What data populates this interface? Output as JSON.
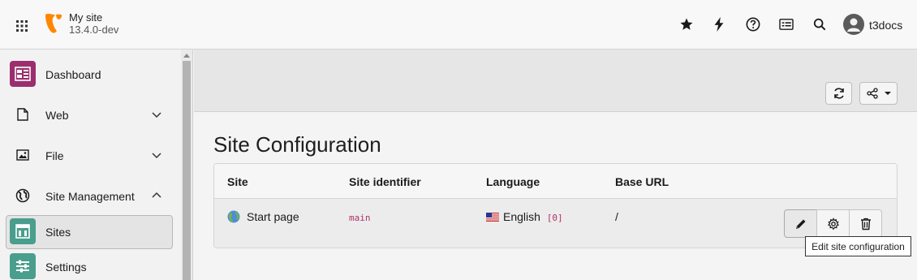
{
  "topbar": {
    "site_name": "My site",
    "site_version": "13.4.0-dev",
    "user_name": "t3docs",
    "icons": [
      "apps-icon",
      "star-icon",
      "bolt-icon",
      "help-icon",
      "list-icon",
      "search-icon",
      "user-avatar-icon"
    ],
    "brand_color": "#ff8700"
  },
  "sidebar": {
    "items": [
      {
        "label": "Dashboard",
        "icon": "dashboard-icon",
        "color": "#9b2e6e"
      },
      {
        "label": "Web",
        "icon": "page-icon"
      },
      {
        "label": "File",
        "icon": "image-icon"
      },
      {
        "label": "Site Management",
        "icon": "globe-icon"
      },
      {
        "label": "Sites",
        "icon": "sites-icon",
        "color": "#4a9e8d"
      },
      {
        "label": "Settings",
        "icon": "settings-icon",
        "color": "#4a9e8d"
      }
    ]
  },
  "main": {
    "title": "Site Configuration",
    "table": {
      "headers": [
        "Site",
        "Site identifier",
        "Language",
        "Base URL"
      ],
      "rows": [
        {
          "site": "Start page",
          "identifier": "main",
          "language": "English",
          "language_id": "[0]",
          "base_url": "/"
        }
      ]
    },
    "tooltip": "Edit site configuration"
  }
}
